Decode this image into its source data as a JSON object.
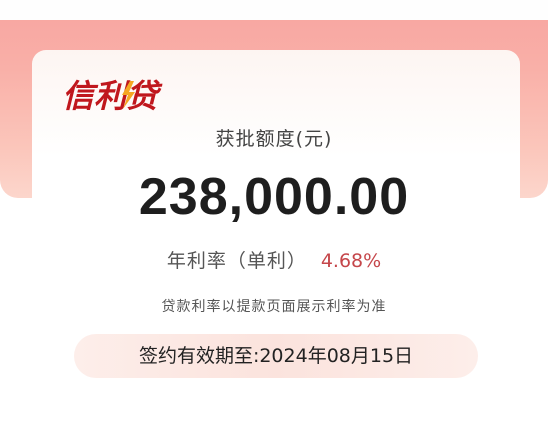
{
  "brand": {
    "logo_text": "信利贷",
    "colors": {
      "logo": "#c0171d",
      "accent": "#f5a623",
      "rate": "#c5464a"
    }
  },
  "approval": {
    "amount_label": "获批额度(元)",
    "amount_value": "238,000.00"
  },
  "rate": {
    "label": "年利率（单利）",
    "value": "4.68%"
  },
  "note": "贷款利率以提款页面展示利率为准",
  "expiry": {
    "text": "签约有效期至:2024年08月15日"
  }
}
